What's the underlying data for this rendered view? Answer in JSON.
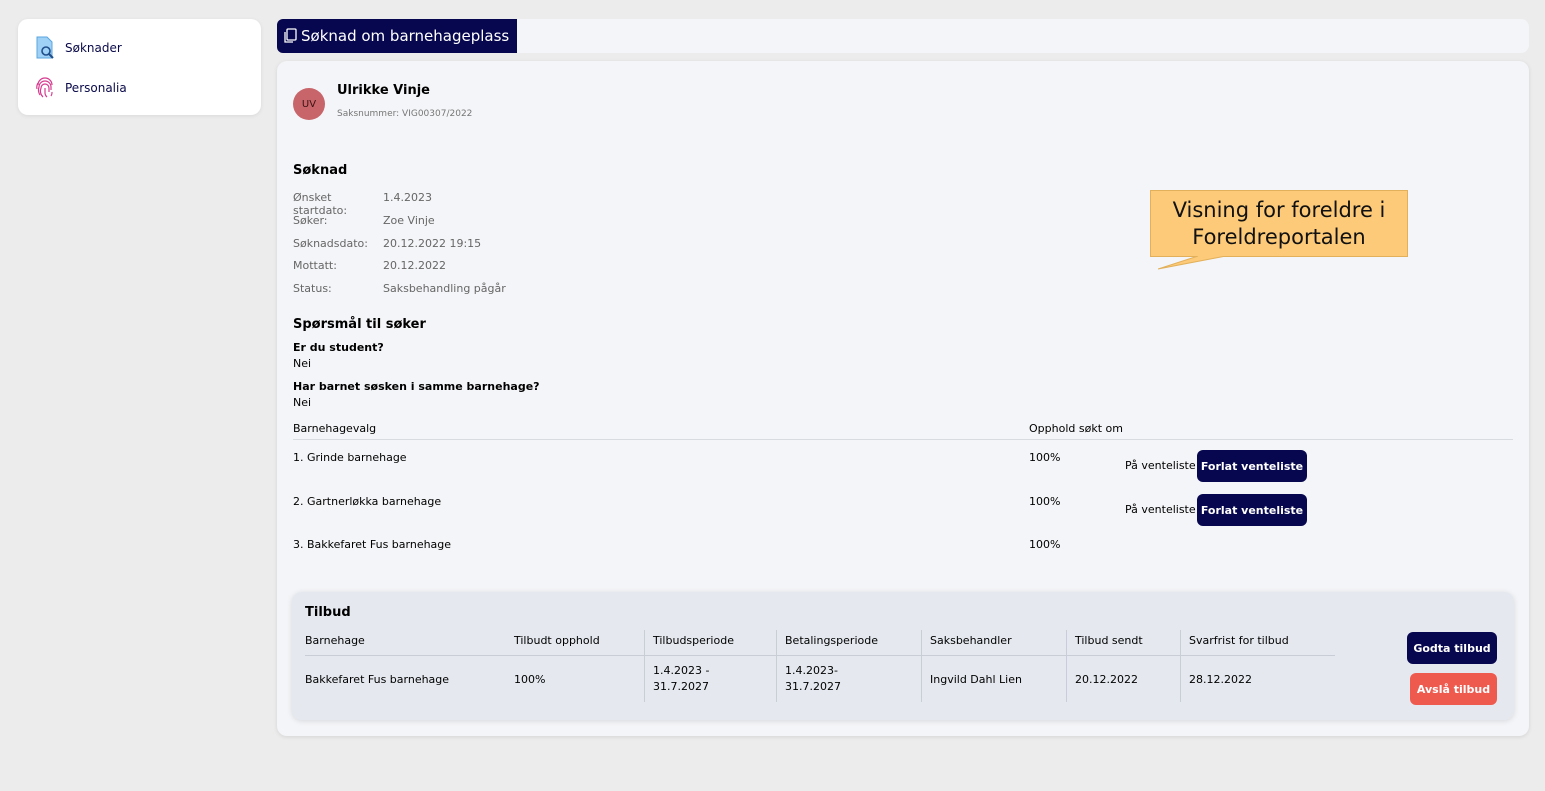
{
  "sidebar": {
    "items": [
      {
        "label": "Søknader",
        "icon": "search-document-icon"
      },
      {
        "label": "Personalia",
        "icon": "fingerprint-icon"
      }
    ]
  },
  "header": {
    "title": "Søknad om barnehageplass"
  },
  "applicant": {
    "initials": "UV",
    "name": "Ulrikke Vinje",
    "case_number": "Saksnummer: VIG00307/2022"
  },
  "application": {
    "heading": "Søknad",
    "fields": [
      {
        "label": "Ønsket startdato:",
        "value": "1.4.2023"
      },
      {
        "label": "Søker:",
        "value": "Zoe Vinje"
      },
      {
        "label": "Søknadsdato:",
        "value": "20.12.2022 19:15"
      },
      {
        "label": "Mottatt:",
        "value": "20.12.2022"
      },
      {
        "label": "Status:",
        "value": "Saksbehandling pågår"
      }
    ]
  },
  "questions": {
    "heading": "Spørsmål til søker",
    "items": [
      {
        "question": "Er du student?",
        "answer": "Nei"
      },
      {
        "question": "Har barnet søsken i samme barnehage?",
        "answer": "Nei"
      }
    ]
  },
  "choices": {
    "col_kindergarten": "Barnehagevalg",
    "col_stay": "Opphold søkt om",
    "rows": [
      {
        "name": "1. Grinde barnehage",
        "pct": "100%",
        "status": "På venteliste",
        "button": "Forlat venteliste"
      },
      {
        "name": "2. Gartnerløkka barnehage",
        "pct": "100%",
        "status": "På venteliste",
        "button": "Forlat venteliste"
      },
      {
        "name": "3. Bakkefaret Fus barnehage",
        "pct": "100%",
        "status": "",
        "button": ""
      }
    ]
  },
  "offer": {
    "heading": "Tilbud",
    "columns": [
      "Barnehage",
      "Tilbudt opphold",
      "Tilbudsperiode",
      "Betalingsperiode",
      "Saksbehandler",
      "Tilbud sendt",
      "Svarfrist for tilbud"
    ],
    "row": [
      "Bakkefaret Fus barnehage",
      "100%",
      "1.4.2023 -\n31.7.2027",
      "1.4.2023-\n31.7.2027",
      "Ingvild Dahl Lien",
      "20.12.2022",
      "28.12.2022"
    ],
    "accept_label": "Godta tilbud",
    "decline_label": "Avslå tilbud"
  },
  "callout": {
    "text": "Visning for foreldre i Foreldreportalen"
  },
  "colors": {
    "navy": "#07074f",
    "danger": "#ef5a4f",
    "avatar": "#c8656a",
    "callout": "#fcca78"
  }
}
